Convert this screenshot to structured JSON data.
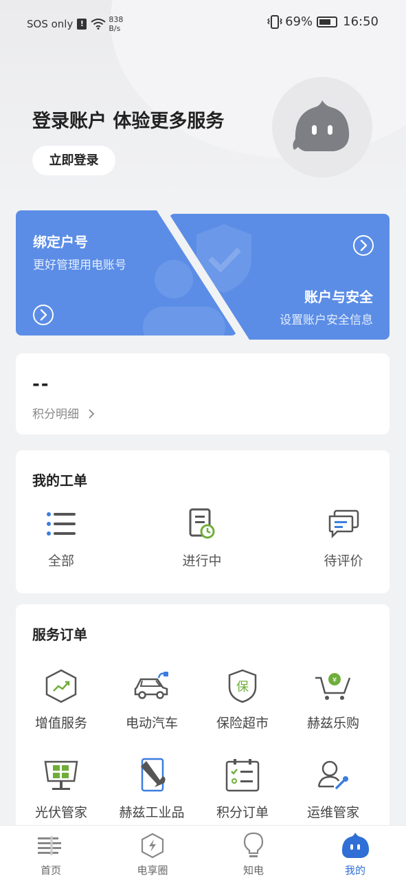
{
  "status_bar": {
    "carrier": "SOS only",
    "net_speed": "838",
    "net_unit": "B/s",
    "battery": "69%",
    "time": "16:50"
  },
  "login": {
    "title": "登录账户 体验更多服务",
    "button": "立即登录"
  },
  "cards": {
    "bind": {
      "title": "绑定户号",
      "subtitle": "更好管理用电账号"
    },
    "security": {
      "title": "账户与安全",
      "subtitle": "设置账户安全信息"
    }
  },
  "points": {
    "value": "--",
    "detail_link": "积分明细"
  },
  "work_orders": {
    "title": "我的工单",
    "items": [
      {
        "label": "全部",
        "icon": "list-icon"
      },
      {
        "label": "进行中",
        "icon": "document-clock-icon"
      },
      {
        "label": "待评价",
        "icon": "chat-icon"
      }
    ]
  },
  "service_orders": {
    "title": "服务订单",
    "items": [
      {
        "label": "增值服务",
        "icon": "growth-hexagon-icon"
      },
      {
        "label": "电动汽车",
        "icon": "electric-car-icon"
      },
      {
        "label": "保险超市",
        "icon": "insurance-shield-icon"
      },
      {
        "label": "赫兹乐购",
        "icon": "shopping-cart-icon"
      },
      {
        "label": "光伏管家",
        "icon": "solar-panel-icon"
      },
      {
        "label": "赫兹工业品",
        "icon": "industrial-tools-icon"
      },
      {
        "label": "积分订单",
        "icon": "points-checklist-icon"
      },
      {
        "label": "运维管家",
        "icon": "maintenance-person-icon"
      }
    ]
  },
  "tabbar": {
    "items": [
      {
        "label": "首页",
        "icon": "home-icon"
      },
      {
        "label": "电享圈",
        "icon": "lightning-hexagon-icon"
      },
      {
        "label": "知电",
        "icon": "lightbulb-icon"
      },
      {
        "label": "我的",
        "icon": "mascot-icon"
      }
    ],
    "active_index": 3,
    "active_color": "#2f6fd6"
  },
  "colors": {
    "card_blue": "#5b8de6",
    "icon_green": "#6fae3a",
    "icon_blue": "#3b7de0"
  }
}
